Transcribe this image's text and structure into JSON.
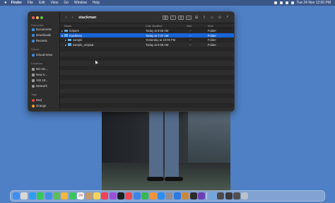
{
  "menubar": {
    "apple": "",
    "items": [
      "Finder",
      "File",
      "Edit",
      "View",
      "Go",
      "Window",
      "Help"
    ],
    "clock": "Tue 24 Nov  12:00 PM"
  },
  "window": {
    "title": "stackman",
    "back": "‹",
    "forward": "›"
  },
  "sidebar": {
    "favourites_label": "Favourites",
    "favourites": [
      {
        "label": "Documents",
        "icon": "document-icon"
      },
      {
        "label": "Downloads",
        "icon": "download-icon"
      },
      {
        "label": "Recents",
        "icon": "clock-icon"
      }
    ],
    "icloud_label": "iCloud",
    "icloud": [
      {
        "label": "iCloud Drive",
        "icon": "cloud-icon"
      }
    ],
    "locations_label": "Locations",
    "locations": [
      {
        "label": "NO NA...",
        "icon": "disk-icon"
      },
      {
        "label": "New V...",
        "icon": "disk-icon"
      },
      {
        "label": "192.18...",
        "icon": "display-icon"
      },
      {
        "label": "Network",
        "icon": "globe-icon"
      }
    ],
    "tags_label": "Tags",
    "tags": [
      {
        "label": "Red",
        "color": "#e3443b"
      },
      {
        "label": "Orange",
        "color": "#f39b2f"
      }
    ]
  },
  "columns": {
    "name": "Name",
    "date": "Date Modified",
    "size": "Size",
    "kind": "Kind"
  },
  "rows": [
    {
      "name": "helpers",
      "date": "Today at 9:58 AM",
      "size": "--",
      "kind": "Folder",
      "level": 0,
      "expanded": false,
      "selected": false
    },
    {
      "name": "machines",
      "date": "Today at 7:37 AM",
      "size": "--",
      "kind": "Folder",
      "level": 0,
      "expanded": true,
      "selected": true
    },
    {
      "name": "sample",
      "date": "Yesterday at 10:09 PM",
      "size": "--",
      "kind": "Folder",
      "level": 1,
      "expanded": false,
      "selected": false
    },
    {
      "name": "sample_original",
      "date": "Today at 9:58 AM",
      "size": "--",
      "kind": "Folder",
      "level": 1,
      "expanded": false,
      "selected": false
    }
  ],
  "dock": [
    {
      "name": "finder",
      "color": "#3d8ff0",
      "glyph": ""
    },
    {
      "name": "launchpad",
      "color": "#d8d8d8",
      "glyph": ""
    },
    {
      "name": "safari",
      "color": "#2f9cf2",
      "glyph": ""
    },
    {
      "name": "messages",
      "color": "#37c859",
      "glyph": ""
    },
    {
      "name": "mail",
      "color": "#3e8ee9",
      "glyph": ""
    },
    {
      "name": "maps",
      "color": "#5bbd5c",
      "glyph": ""
    },
    {
      "name": "photos",
      "color": "#f2b73d",
      "glyph": ""
    },
    {
      "name": "facetime",
      "color": "#3cc45a",
      "glyph": ""
    },
    {
      "name": "calendar",
      "color": "#f5f5f5",
      "glyph": "24"
    },
    {
      "name": "contacts",
      "color": "#c49a6c",
      "glyph": ""
    },
    {
      "name": "notes",
      "color": "#f4d35a",
      "glyph": ""
    },
    {
      "name": "music",
      "color": "#f0405a",
      "glyph": ""
    },
    {
      "name": "podcasts",
      "color": "#9a50d6",
      "glyph": ""
    },
    {
      "name": "tv",
      "color": "#1f1f1f",
      "glyph": ""
    },
    {
      "name": "news",
      "color": "#ef4a4f",
      "glyph": ""
    },
    {
      "name": "keynote",
      "color": "#3a86e0",
      "glyph": ""
    },
    {
      "name": "numbers",
      "color": "#3bb455",
      "glyph": ""
    },
    {
      "name": "pages",
      "color": "#f2943a",
      "glyph": ""
    },
    {
      "name": "app-store",
      "color": "#2d8df0",
      "glyph": ""
    },
    {
      "name": "system-preferences",
      "color": "#8e8e93",
      "glyph": ""
    },
    {
      "name": "xcode",
      "color": "#2a7ae0",
      "glyph": ""
    },
    {
      "name": "sequel",
      "color": "#c9893c",
      "glyph": ""
    },
    {
      "name": "terminal",
      "color": "#2b2b2b",
      "glyph": ""
    },
    {
      "name": "github",
      "color": "#6d3fb5",
      "glyph": ""
    },
    {
      "name": "sep",
      "color": "",
      "glyph": ""
    },
    {
      "name": "preview",
      "color": "#6fa7dc",
      "glyph": ""
    },
    {
      "name": "screenshot",
      "color": "#4a4a4a",
      "glyph": ""
    },
    {
      "name": "window-1",
      "color": "#3a3a3a",
      "glyph": ""
    },
    {
      "name": "window-2",
      "color": "#505050",
      "glyph": ""
    },
    {
      "name": "trash",
      "color": "#b9c2cc",
      "glyph": ""
    }
  ]
}
